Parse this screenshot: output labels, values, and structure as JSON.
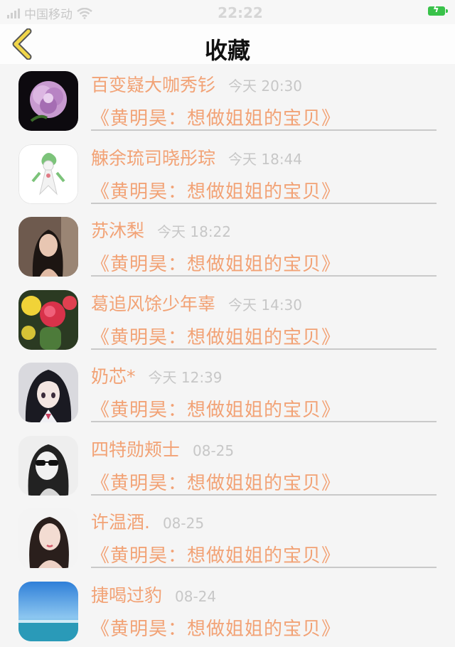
{
  "status": {
    "carrier": "中国移动",
    "time": "22:22"
  },
  "nav": {
    "title": "收藏",
    "back_icon": "chevron-left-icon"
  },
  "colors": {
    "accent": "#f2a275",
    "back": "#f1d64a",
    "time": "#c7c7c7"
  },
  "items": [
    {
      "name": "百变嶷大咖秀钐",
      "time": "今天 20:30",
      "message": "《黄明昊：想做姐姐的宝贝》",
      "avatar": "rose-avatar"
    },
    {
      "name": "觫余琉司晓彤琮",
      "time": "今天 18:44",
      "message": "《黄明昊：想做姐姐的宝贝》",
      "avatar": "pokemon-avatar"
    },
    {
      "name": "苏沐梨",
      "time": "今天 18:22",
      "message": "《黄明昊：想做姐姐的宝贝》",
      "avatar": "woman-portrait-avatar"
    },
    {
      "name": "葛追风馀少年辜",
      "time": "今天 14:30",
      "message": "《黄明昊：想做姐姐的宝贝》",
      "avatar": "cactus-flower-avatar"
    },
    {
      "name": "奶芯*",
      "time": "今天 12:39",
      "message": "《黄明昊：想做姐姐的宝贝》",
      "avatar": "anime-girl-avatar"
    },
    {
      "name": "四特勋颊士",
      "time": "08-25",
      "message": "《黄明昊：想做姐姐的宝贝》",
      "avatar": "sunglasses-avatar"
    },
    {
      "name": "许温酒.",
      "time": "08-25",
      "message": "《黄明昊：想做姐姐的宝贝》",
      "avatar": "girl-portrait-avatar"
    },
    {
      "name": "捷喝过豹",
      "time": "08-24",
      "message": "《黄明昊：想做姐姐的宝贝》",
      "avatar": "sky-sea-avatar"
    }
  ]
}
